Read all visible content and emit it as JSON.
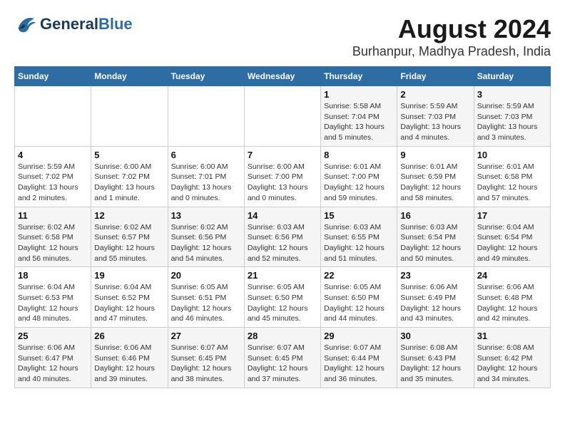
{
  "logo": {
    "general": "General",
    "blue": "Blue"
  },
  "header": {
    "month_year": "August 2024",
    "location": "Burhanpur, Madhya Pradesh, India"
  },
  "weekdays": [
    "Sunday",
    "Monday",
    "Tuesday",
    "Wednesday",
    "Thursday",
    "Friday",
    "Saturday"
  ],
  "weeks": [
    [
      {
        "day": "",
        "info": ""
      },
      {
        "day": "",
        "info": ""
      },
      {
        "day": "",
        "info": ""
      },
      {
        "day": "",
        "info": ""
      },
      {
        "day": "1",
        "info": "Sunrise: 5:58 AM\nSunset: 7:04 PM\nDaylight: 13 hours\nand 5 minutes."
      },
      {
        "day": "2",
        "info": "Sunrise: 5:59 AM\nSunset: 7:03 PM\nDaylight: 13 hours\nand 4 minutes."
      },
      {
        "day": "3",
        "info": "Sunrise: 5:59 AM\nSunset: 7:03 PM\nDaylight: 13 hours\nand 3 minutes."
      }
    ],
    [
      {
        "day": "4",
        "info": "Sunrise: 5:59 AM\nSunset: 7:02 PM\nDaylight: 13 hours\nand 2 minutes."
      },
      {
        "day": "5",
        "info": "Sunrise: 6:00 AM\nSunset: 7:02 PM\nDaylight: 13 hours\nand 1 minute."
      },
      {
        "day": "6",
        "info": "Sunrise: 6:00 AM\nSunset: 7:01 PM\nDaylight: 13 hours\nand 0 minutes."
      },
      {
        "day": "7",
        "info": "Sunrise: 6:00 AM\nSunset: 7:00 PM\nDaylight: 13 hours\nand 0 minutes."
      },
      {
        "day": "8",
        "info": "Sunrise: 6:01 AM\nSunset: 7:00 PM\nDaylight: 12 hours\nand 59 minutes."
      },
      {
        "day": "9",
        "info": "Sunrise: 6:01 AM\nSunset: 6:59 PM\nDaylight: 12 hours\nand 58 minutes."
      },
      {
        "day": "10",
        "info": "Sunrise: 6:01 AM\nSunset: 6:58 PM\nDaylight: 12 hours\nand 57 minutes."
      }
    ],
    [
      {
        "day": "11",
        "info": "Sunrise: 6:02 AM\nSunset: 6:58 PM\nDaylight: 12 hours\nand 56 minutes."
      },
      {
        "day": "12",
        "info": "Sunrise: 6:02 AM\nSunset: 6:57 PM\nDaylight: 12 hours\nand 55 minutes."
      },
      {
        "day": "13",
        "info": "Sunrise: 6:02 AM\nSunset: 6:56 PM\nDaylight: 12 hours\nand 54 minutes."
      },
      {
        "day": "14",
        "info": "Sunrise: 6:03 AM\nSunset: 6:56 PM\nDaylight: 12 hours\nand 52 minutes."
      },
      {
        "day": "15",
        "info": "Sunrise: 6:03 AM\nSunset: 6:55 PM\nDaylight: 12 hours\nand 51 minutes."
      },
      {
        "day": "16",
        "info": "Sunrise: 6:03 AM\nSunset: 6:54 PM\nDaylight: 12 hours\nand 50 minutes."
      },
      {
        "day": "17",
        "info": "Sunrise: 6:04 AM\nSunset: 6:54 PM\nDaylight: 12 hours\nand 49 minutes."
      }
    ],
    [
      {
        "day": "18",
        "info": "Sunrise: 6:04 AM\nSunset: 6:53 PM\nDaylight: 12 hours\nand 48 minutes."
      },
      {
        "day": "19",
        "info": "Sunrise: 6:04 AM\nSunset: 6:52 PM\nDaylight: 12 hours\nand 47 minutes."
      },
      {
        "day": "20",
        "info": "Sunrise: 6:05 AM\nSunset: 6:51 PM\nDaylight: 12 hours\nand 46 minutes."
      },
      {
        "day": "21",
        "info": "Sunrise: 6:05 AM\nSunset: 6:50 PM\nDaylight: 12 hours\nand 45 minutes."
      },
      {
        "day": "22",
        "info": "Sunrise: 6:05 AM\nSunset: 6:50 PM\nDaylight: 12 hours\nand 44 minutes."
      },
      {
        "day": "23",
        "info": "Sunrise: 6:06 AM\nSunset: 6:49 PM\nDaylight: 12 hours\nand 43 minutes."
      },
      {
        "day": "24",
        "info": "Sunrise: 6:06 AM\nSunset: 6:48 PM\nDaylight: 12 hours\nand 42 minutes."
      }
    ],
    [
      {
        "day": "25",
        "info": "Sunrise: 6:06 AM\nSunset: 6:47 PM\nDaylight: 12 hours\nand 40 minutes."
      },
      {
        "day": "26",
        "info": "Sunrise: 6:06 AM\nSunset: 6:46 PM\nDaylight: 12 hours\nand 39 minutes."
      },
      {
        "day": "27",
        "info": "Sunrise: 6:07 AM\nSunset: 6:45 PM\nDaylight: 12 hours\nand 38 minutes."
      },
      {
        "day": "28",
        "info": "Sunrise: 6:07 AM\nSunset: 6:45 PM\nDaylight: 12 hours\nand 37 minutes."
      },
      {
        "day": "29",
        "info": "Sunrise: 6:07 AM\nSunset: 6:44 PM\nDaylight: 12 hours\nand 36 minutes."
      },
      {
        "day": "30",
        "info": "Sunrise: 6:08 AM\nSunset: 6:43 PM\nDaylight: 12 hours\nand 35 minutes."
      },
      {
        "day": "31",
        "info": "Sunrise: 6:08 AM\nSunset: 6:42 PM\nDaylight: 12 hours\nand 34 minutes."
      }
    ]
  ]
}
